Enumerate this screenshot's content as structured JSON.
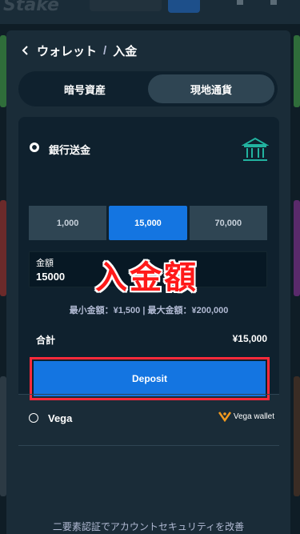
{
  "background": {
    "logo": "Stake",
    "colors": {
      "accent": "#1475e1",
      "strip_colors": [
        "#3aa047",
        "#b33636",
        "#7b3aa0",
        "#a06a3a"
      ]
    }
  },
  "header": {
    "back_icon": "chevron-left-icon",
    "wallet": "ウォレット",
    "separator": "/",
    "deposit": "入金"
  },
  "tabs": [
    {
      "label": "暗号資産",
      "active": false
    },
    {
      "label": "現地通貨",
      "active": true
    }
  ],
  "bank_transfer": {
    "label": "銀行送金",
    "selected": true,
    "icon": "bank-icon",
    "amount_options": [
      {
        "label": "1,000",
        "selected": false
      },
      {
        "label": "15,000",
        "selected": true
      },
      {
        "label": "70,000",
        "selected": false
      }
    ],
    "amount_field": {
      "label": "金額",
      "value": "15000"
    },
    "annotation": "入金額",
    "limits": "最小金額：¥1,500 | 最大金額：¥200,000",
    "total_label": "合計",
    "total_value": "¥15,000",
    "deposit_button": "Deposit"
  },
  "vega": {
    "label": "Vega",
    "selected": false,
    "logo_text": "Vega wallet",
    "logo_icon": "vega-v-icon"
  },
  "footer": {
    "text": "二要素認証でアカウントセキュリティを改善"
  }
}
